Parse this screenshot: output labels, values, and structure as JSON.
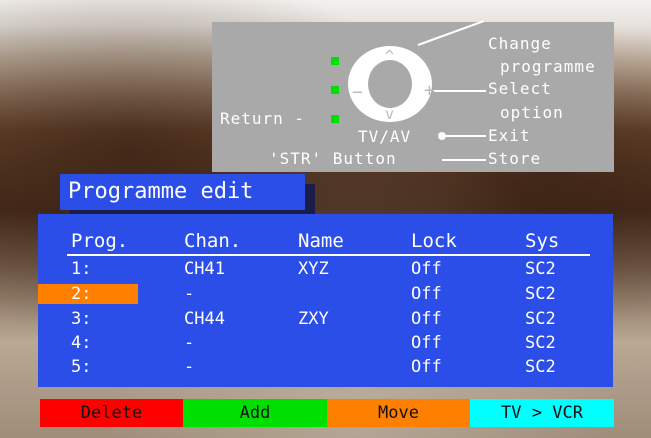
{
  "help": {
    "change": "Change",
    "programme": "programme",
    "select": "Select",
    "option": "option",
    "return": "Return -",
    "tvav": "TV/AV",
    "exit": "Exit",
    "str": "'STR' Button",
    "store": "Store",
    "up_glyph": "^",
    "down_glyph": "v",
    "minus_glyph": "−",
    "plus_glyph": "+"
  },
  "title": "Programme edit",
  "table": {
    "headers": [
      "Prog.",
      "Chan.",
      "Name",
      "Lock",
      "Sys"
    ],
    "rows": [
      {
        "prog": "1:",
        "chan": "CH41",
        "name": "XYZ",
        "lock": "Off",
        "sys": "SC2",
        "selected": false
      },
      {
        "prog": "2:",
        "chan": "-",
        "name": "",
        "lock": "Off",
        "sys": "SC2",
        "selected": true
      },
      {
        "prog": "3:",
        "chan": "CH44",
        "name": "ZXY",
        "lock": "Off",
        "sys": "SC2",
        "selected": false
      },
      {
        "prog": "4:",
        "chan": "-",
        "name": "",
        "lock": "Off",
        "sys": "SC2",
        "selected": false
      },
      {
        "prog": "5:",
        "chan": "-",
        "name": "",
        "lock": "Off",
        "sys": "SC2",
        "selected": false
      }
    ]
  },
  "buttons": [
    {
      "label": "Delete",
      "color": "#ff0000"
    },
    {
      "label": "Add",
      "color": "#00e000"
    },
    {
      "label": "Move",
      "color": "#ff7f00"
    },
    {
      "label": "TV > VCR",
      "color": "#00ffff"
    }
  ],
  "colors": {
    "panel": "#2b4de8",
    "highlight": "#ff7f00",
    "indicator": "#00e000"
  }
}
